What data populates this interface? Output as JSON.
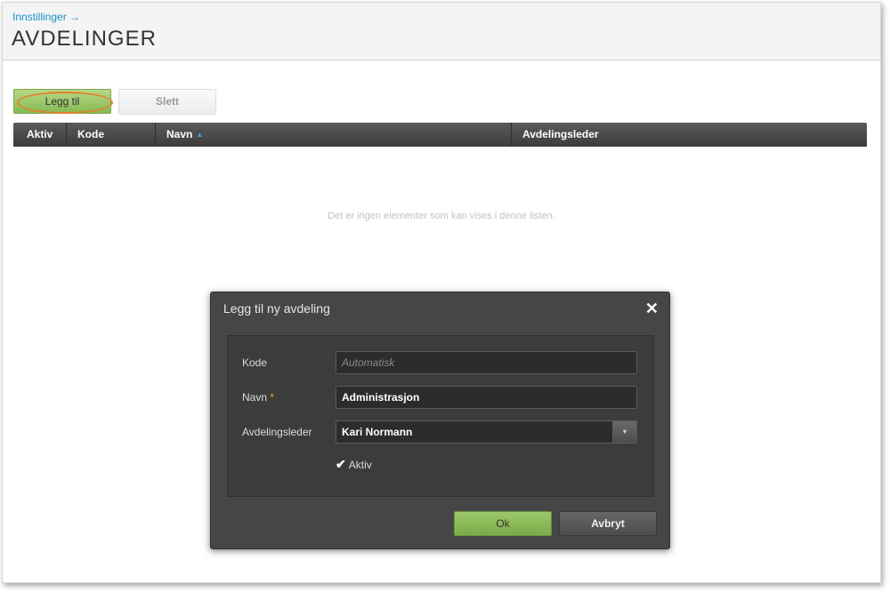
{
  "header": {
    "breadcrumb": "Innstillinger →",
    "title": "AVDELINGER"
  },
  "toolbar": {
    "add_label": "Legg til",
    "delete_label": "Slett"
  },
  "grid": {
    "columns": [
      "Aktiv",
      "Kode",
      "Navn",
      "Avdelingsleder"
    ],
    "sort_indicator": "▲",
    "empty_message": "Det er ingen elementer som kan vises i denne listen."
  },
  "dialog": {
    "title": "Legg til ny avdeling",
    "close_glyph": "✕",
    "fields": {
      "kode": {
        "label": "Kode",
        "placeholder": "Automatisk"
      },
      "navn": {
        "label": "Navn",
        "required_mark": "*",
        "value": "Administrasjon"
      },
      "leder": {
        "label": "Avdelingsleder",
        "value": "Kari Normann",
        "arrow": "▾"
      }
    },
    "active": {
      "label": "Aktiv",
      "checked": true,
      "glyph": "✔"
    },
    "ok_label": "Ok",
    "cancel_label": "Avbryt"
  },
  "colors": {
    "accent_link": "#1b8fc9",
    "primary_button": "#86b953",
    "dialog_bg": "#464646",
    "highlight_ring": "#e0852f"
  },
  "icons": [
    "arrow-right-icon",
    "sort-asc-icon",
    "close-icon",
    "dropdown-arrow-icon",
    "checkmark-icon"
  ]
}
